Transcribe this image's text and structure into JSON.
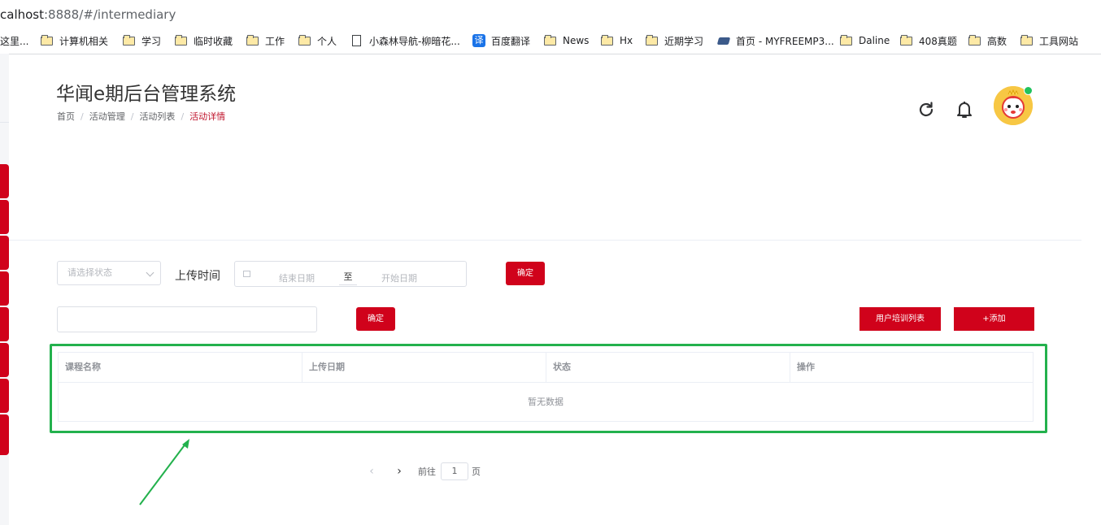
{
  "browser": {
    "url_host": "calhost",
    "url_rest": ":8888/#/intermediary"
  },
  "bookmarks": [
    {
      "label": "这里...",
      "icon": "folder-icon"
    },
    {
      "label": "计算机相关",
      "icon": "folder-icon"
    },
    {
      "label": "学习",
      "icon": "folder-icon"
    },
    {
      "label": "临时收藏",
      "icon": "folder-icon"
    },
    {
      "label": "工作",
      "icon": "folder-icon"
    },
    {
      "label": "个人",
      "icon": "folder-icon"
    },
    {
      "label": "小森林导航-柳暗花...",
      "icon": "page-icon"
    },
    {
      "label": "百度翻译",
      "icon": "translate-icon"
    },
    {
      "label": "News",
      "icon": "folder-icon"
    },
    {
      "label": "Hx",
      "icon": "folder-icon"
    },
    {
      "label": "近期学习",
      "icon": "folder-icon"
    },
    {
      "label": "首页 - MYFREEMP3...",
      "icon": "mp3-site-icon"
    },
    {
      "label": "Daline",
      "icon": "folder-icon"
    },
    {
      "label": "408真题",
      "icon": "folder-icon"
    },
    {
      "label": "高数",
      "icon": "folder-icon"
    },
    {
      "label": "工具网站",
      "icon": "folder-icon"
    }
  ],
  "translate_glyph": "译",
  "header": {
    "title": "华闻e期后台管理系统",
    "breadcrumb": [
      "首页",
      "活动管理",
      "活动列表",
      "活动详情"
    ],
    "separator": "/"
  },
  "filters": {
    "status_placeholder": "请选择状态",
    "upload_time_label": "上传时间",
    "date_start_placeholder": "结束日期",
    "date_separator": "至",
    "date_end_placeholder": "开始日期",
    "confirm_label": "确定",
    "search_value": "",
    "search_confirm_label": "确定",
    "training_list_label": "用户培训列表",
    "add_label": "+添加"
  },
  "table": {
    "columns": [
      "课程名称",
      "上传日期",
      "状态",
      "操作"
    ],
    "empty_text": "暂无数据"
  },
  "pagination": {
    "prev_glyph": "‹",
    "next_glyph": "›",
    "goto_label": "前往",
    "page_value": "1",
    "page_suffix": "页"
  },
  "colors": {
    "accent_red": "#d0021b",
    "highlight_green": "#23b14d",
    "online_green": "#21c25e"
  }
}
